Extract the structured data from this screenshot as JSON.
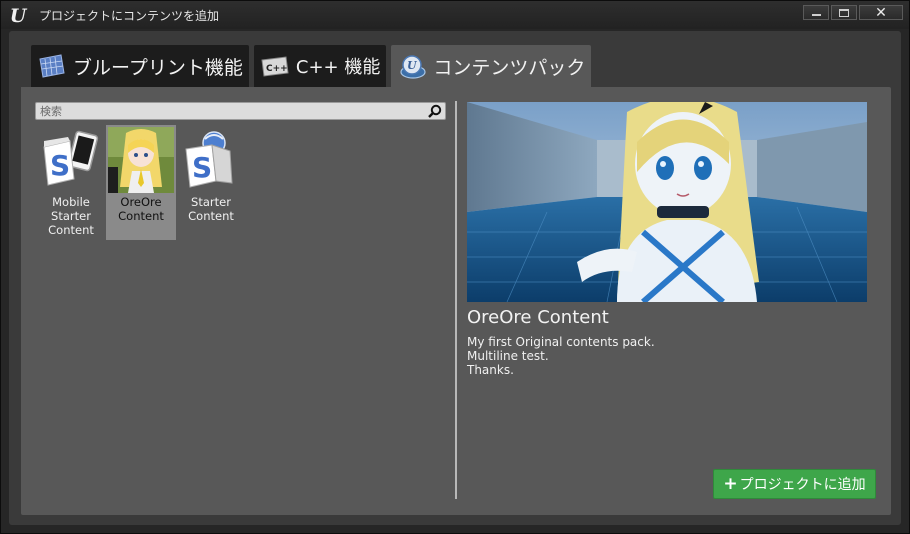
{
  "window": {
    "title": "プロジェクトにコンテンツを追加",
    "logo": "U",
    "controls": [
      "minimize-icon",
      "maximize-icon",
      "close-icon"
    ],
    "close_label": "✕"
  },
  "tabs": [
    {
      "label": "ブループリント機能",
      "icon": "blueprint-icon",
      "active": false
    },
    {
      "label": "C++ 機能",
      "icon": "cpp-icon",
      "icon_text": "C++",
      "active": false
    },
    {
      "label": "コンテンツパック",
      "icon": "content-pack-icon",
      "active": true
    }
  ],
  "search": {
    "placeholder": "検索",
    "value": ""
  },
  "tiles": [
    {
      "label": "Mobile\nStarter\nContent",
      "icon": "mobile-starter-icon",
      "selected": false
    },
    {
      "label": "OreOre\nContent",
      "icon": "oreore-thumbnail",
      "selected": true
    },
    {
      "label": "Starter\nContent",
      "icon": "starter-content-icon",
      "selected": false
    }
  ],
  "detail": {
    "title": "OreOre Content",
    "description": "My first Original contents pack.\nMultiline test.\nThanks."
  },
  "add_button": {
    "plus": "+",
    "label": "プロジェクトに追加"
  },
  "colors": {
    "accent_green": "#3ea64a",
    "panel_gray": "#585858",
    "tab_active": "#585858",
    "tab_inactive": "#1c1c1c",
    "selection_gray": "#8a8a8a"
  }
}
